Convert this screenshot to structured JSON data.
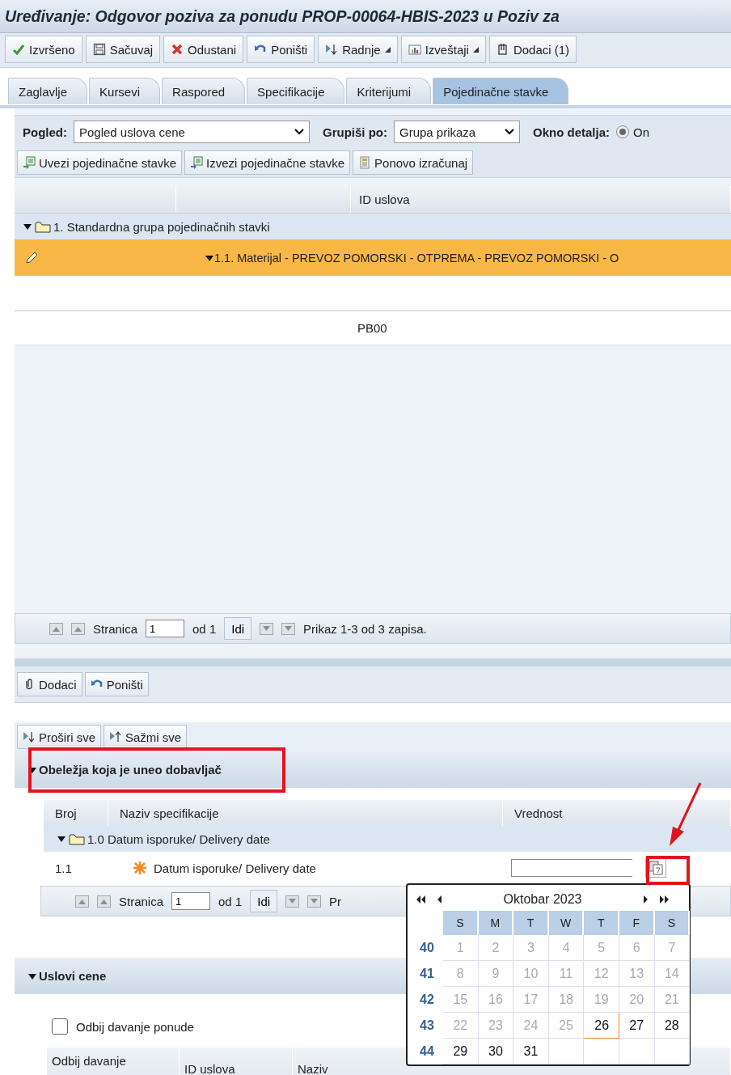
{
  "window": {
    "title": "Uređivanje: Odgovor poziva za ponudu PROP-00064-HBIS-2023 u Poziv za"
  },
  "toolbar": [
    {
      "label": "Izvršeno",
      "kind": "check",
      "menu": false
    },
    {
      "label": "Sačuvaj",
      "kind": "save",
      "menu": false
    },
    {
      "label": "Odustani",
      "kind": "cancel",
      "menu": false
    },
    {
      "label": "Poništi",
      "kind": "undo",
      "menu": false
    },
    {
      "label": "Radnje",
      "kind": "actions",
      "menu": true
    },
    {
      "label": "Izveštaji",
      "kind": "report",
      "menu": true
    },
    {
      "label": "Dodaci (1)",
      "kind": "attach",
      "menu": false
    }
  ],
  "tabs": [
    {
      "label": "Zaglavlje",
      "selected": false
    },
    {
      "label": "Kursevi",
      "selected": false
    },
    {
      "label": "Raspored",
      "selected": false
    },
    {
      "label": "Specifikacije",
      "selected": false
    },
    {
      "label": "Kriterijumi",
      "selected": false
    },
    {
      "label": "Pojedinačne stavke",
      "selected": true
    }
  ],
  "filters": {
    "view_label": "Pogled:",
    "view_value": "Pogled uslova cene",
    "group_label": "Grupiši po:",
    "group_value": "Grupa prikaza",
    "detail_label": "Okno detalja:",
    "detail_option": {
      "label": "On",
      "selected": true
    }
  },
  "item_actions": [
    {
      "label": "Uvezi pojedinačne stavke",
      "kind": "import"
    },
    {
      "label": "Izvezi pojedinačne stavke",
      "kind": "export"
    },
    {
      "label": "Ponovo izračunaj",
      "kind": "calc"
    }
  ],
  "items_table": {
    "columns": [
      "ID uslova"
    ],
    "group": {
      "label": "1. Standardna grupa pojedinačnih stavki",
      "expanded": true
    },
    "item": {
      "label": "1.1. Materijal - PREVOZ POMORSKI - OTPREMA - PREVOZ POMORSKI - O",
      "expanded": true,
      "selected": true
    },
    "rows": [
      {
        "id": "PB00"
      }
    ]
  },
  "pager": {
    "label": "Stranica",
    "page": "1",
    "of": "od 1",
    "go": "Idi",
    "summary": "Prikaz 1-3 od 3 zapisa."
  },
  "detail_toolbar": [
    {
      "label": "Dodaci",
      "kind": "clip"
    },
    {
      "label": "Poništi",
      "kind": "undo"
    }
  ],
  "expand_buttons": [
    {
      "label": "Proširi sve",
      "kind": "expand"
    },
    {
      "label": "Sažmi sve",
      "kind": "collapse"
    }
  ],
  "supplier_section": {
    "title": "Obeležja koja je uneo dobavljač",
    "expanded": true,
    "columns": [
      "Broj",
      "Naziv specifikacije",
      "Vrednost"
    ],
    "group": {
      "label": "1.0 Datum isporuke/ Delivery date",
      "expanded": true
    },
    "rows": [
      {
        "number": "1.1",
        "required": true,
        "name": "Datum isporuke/ Delivery date"
      }
    ],
    "pager": {
      "label": "Stranica",
      "page": "1",
      "of": "od 1",
      "go": "Idi",
      "summary": "Pr"
    }
  },
  "price_section": {
    "title": "Uslovi cene",
    "expanded": true,
    "decline": {
      "label": "Odbij davanje ponude",
      "checked": false
    },
    "columns": [
      "Odbij davanje",
      "ID uslova",
      "Naziv"
    ]
  },
  "calendar": {
    "title": "Oktobar 2023",
    "weekdays": [
      "S",
      "M",
      "T",
      "W",
      "T",
      "F",
      "S"
    ],
    "weeks": [
      {
        "number": "40",
        "days": [
          {
            "label": "1",
            "enabled": false,
            "today": false
          },
          {
            "label": "2",
            "enabled": false,
            "today": false
          },
          {
            "label": "3",
            "enabled": false,
            "today": false
          },
          {
            "label": "4",
            "enabled": false,
            "today": false
          },
          {
            "label": "5",
            "enabled": false,
            "today": false
          },
          {
            "label": "6",
            "enabled": false,
            "today": false
          },
          {
            "label": "7",
            "enabled": false,
            "today": false
          }
        ]
      },
      {
        "number": "41",
        "days": [
          {
            "label": "8",
            "enabled": false,
            "today": false
          },
          {
            "label": "9",
            "enabled": false,
            "today": false
          },
          {
            "label": "10",
            "enabled": false,
            "today": false
          },
          {
            "label": "11",
            "enabled": false,
            "today": false
          },
          {
            "label": "12",
            "enabled": false,
            "today": false
          },
          {
            "label": "13",
            "enabled": false,
            "today": false
          },
          {
            "label": "14",
            "enabled": false,
            "today": false
          }
        ]
      },
      {
        "number": "42",
        "days": [
          {
            "label": "15",
            "enabled": false,
            "today": false
          },
          {
            "label": "16",
            "enabled": false,
            "today": false
          },
          {
            "label": "17",
            "enabled": false,
            "today": false
          },
          {
            "label": "18",
            "enabled": false,
            "today": false
          },
          {
            "label": "19",
            "enabled": false,
            "today": false
          },
          {
            "label": "20",
            "enabled": false,
            "today": false
          },
          {
            "label": "21",
            "enabled": false,
            "today": false
          }
        ]
      },
      {
        "number": "43",
        "days": [
          {
            "label": "22",
            "enabled": false,
            "today": false
          },
          {
            "label": "23",
            "enabled": false,
            "today": false
          },
          {
            "label": "24",
            "enabled": false,
            "today": false
          },
          {
            "label": "25",
            "enabled": false,
            "today": false
          },
          {
            "label": "26",
            "enabled": true,
            "today": true
          },
          {
            "label": "27",
            "enabled": true,
            "today": false
          },
          {
            "label": "28",
            "enabled": true,
            "today": false
          }
        ]
      },
      {
        "number": "44",
        "days": [
          {
            "label": "29",
            "enabled": true,
            "today": false
          },
          {
            "label": "30",
            "enabled": true,
            "today": false
          },
          {
            "label": "31",
            "enabled": true,
            "today": false
          }
        ]
      }
    ]
  }
}
